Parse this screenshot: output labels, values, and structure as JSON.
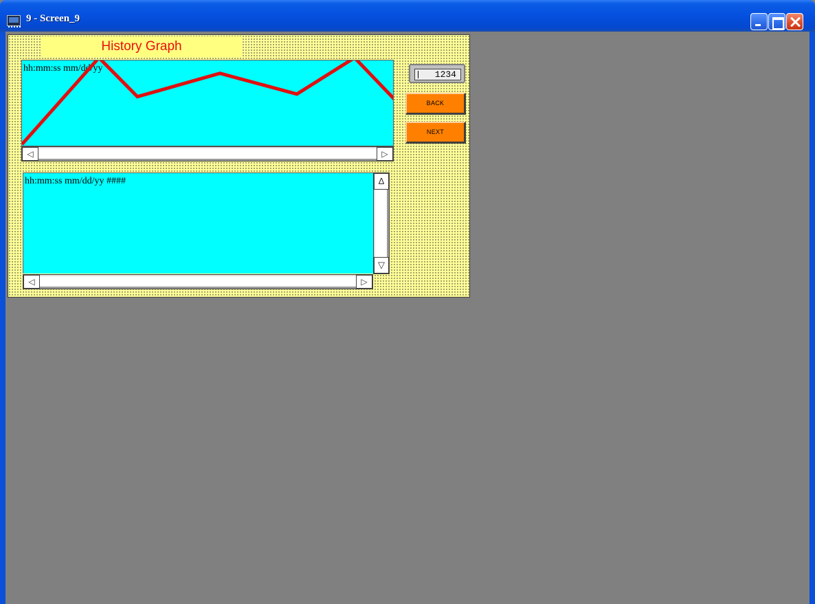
{
  "window": {
    "title": "9 - Screen_9"
  },
  "panel": {
    "title": "History Graph",
    "graph_label": "hh:mm:ss  mm/dd/yy",
    "log_label": "hh:mm:ss   mm/dd/yy  ####",
    "counter_value": "1234",
    "back_label": "BACK",
    "next_label": "NEXT"
  },
  "colors": {
    "panel_bg": "#ffff99",
    "graph_bg": "#00ffff",
    "trend_line": "#e01010",
    "button_bg": "#ff8000",
    "title_text": "#e81010"
  },
  "icons": {
    "scroll_left": "◁",
    "scroll_right": "▷",
    "scroll_up": "Δ",
    "scroll_down": "▽"
  },
  "trend": {
    "values": [
      0,
      100,
      55,
      82,
      58,
      100,
      52
    ]
  }
}
